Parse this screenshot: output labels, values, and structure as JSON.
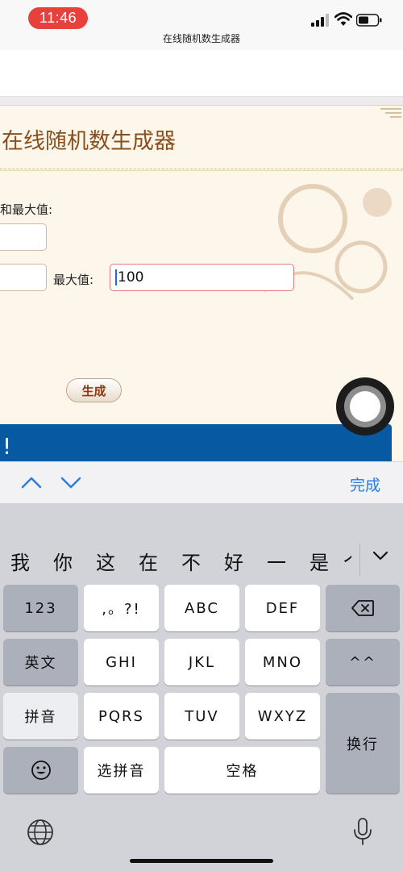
{
  "status_bar": {
    "time": "11:46",
    "page_title": "在线随机数生成器"
  },
  "card": {
    "title": "在线随机数生成器",
    "minmax_label": "和最大值:",
    "max_label": "最大值:",
    "max_value": "100",
    "generate_label": "生成",
    "banner_text": "!"
  },
  "toolbar": {
    "done_label": "完成"
  },
  "keyboard": {
    "candidates": [
      "我",
      "你",
      "这",
      "在",
      "不",
      "好",
      "一",
      "是",
      "个"
    ],
    "keys": {
      "k123": "123",
      "punct": ",。?!",
      "abc": "ABC",
      "def": "DEF",
      "english": "英文",
      "ghi": "GHI",
      "jkl": "JKL",
      "mno": "MNO",
      "emoticon": "^^",
      "pinyin": "拼音",
      "pqrs": "PQRS",
      "tuv": "TUV",
      "wxyz": "WXYZ",
      "newline": "换行",
      "select_pinyin": "选拼音",
      "space": "空格"
    }
  },
  "colors": {
    "accent_blue": "#075aa1",
    "title_brown": "#8a4f1d",
    "done_blue": "#2a7be0",
    "time_red": "#e8413c"
  }
}
